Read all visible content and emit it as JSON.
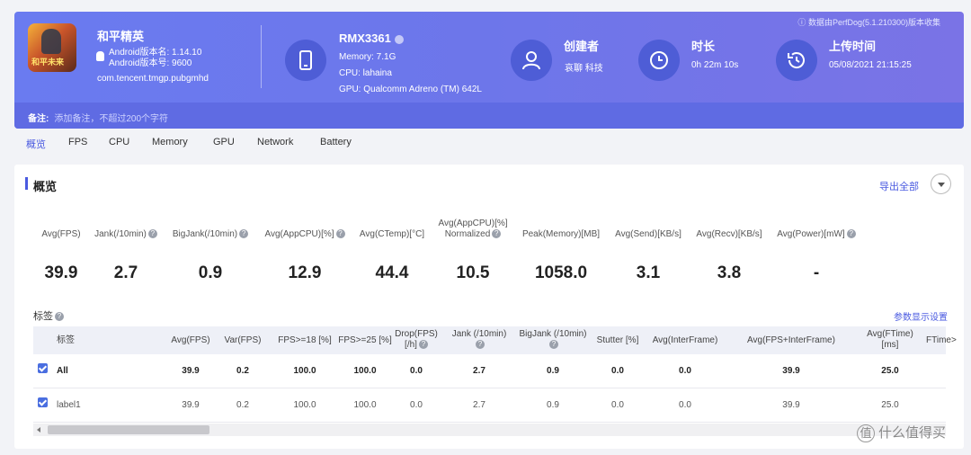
{
  "header": {
    "app": {
      "name": "和平精英",
      "version_name": "Android版本名: 1.14.10",
      "version_code": "Android版本号: 9600",
      "package": "com.tencent.tmgp.pubgmhd",
      "icon_text": "和平未来"
    },
    "device": {
      "name": "RMX3361",
      "memory": "Memory: 7.1G",
      "cpu": "CPU: lahaina",
      "gpu": "GPU: Qualcomm Adreno (TM) 642L"
    },
    "creator": {
      "title": "创建者",
      "value": "哀聊 科技"
    },
    "duration": {
      "title": "时长",
      "value": "0h 22m 10s"
    },
    "upload": {
      "title": "上传时间",
      "value": "05/08/2021 21:15:25"
    },
    "perfdog_note": "数据由PerfDog(5.1.210300)版本收集",
    "note_label": "备注:",
    "note_placeholder": "添加备注，不超过200个字符"
  },
  "tabs": [
    "概览",
    "FPS",
    "CPU",
    "Memory",
    "GPU",
    "Network",
    "Battery"
  ],
  "overview": {
    "title": "概览",
    "export_label": "导出全部",
    "stats": [
      {
        "label": "Avg(FPS)",
        "label2": "",
        "value": "39.9",
        "help": false
      },
      {
        "label": "Jank(/10min)",
        "label2": "",
        "value": "2.7",
        "help": true
      },
      {
        "label": "BigJank(/10min)",
        "label2": "",
        "value": "0.9",
        "help": true
      },
      {
        "label": "Avg(AppCPU)[%]",
        "label2": "",
        "value": "12.9",
        "help": true
      },
      {
        "label": "Avg(CTemp)[°C]",
        "label2": "",
        "value": "44.4",
        "help": false
      },
      {
        "label": "Avg(AppCPU)[%]",
        "label2": "Normalized",
        "value": "10.5",
        "help": true
      },
      {
        "label": "Peak(Memory)[MB]",
        "label2": "",
        "value": "1058.0",
        "help": false
      },
      {
        "label": "Avg(Send)[KB/s]",
        "label2": "",
        "value": "3.1",
        "help": false
      },
      {
        "label": "Avg(Recv)[KB/s]",
        "label2": "",
        "value": "3.8",
        "help": false
      },
      {
        "label": "Avg(Power)[mW]",
        "label2": "",
        "value": "-",
        "help": true
      }
    ]
  },
  "tags": {
    "title": "标签",
    "settings_link": "参数显示设置",
    "columns": [
      {
        "label": "标签",
        "label2": ""
      },
      {
        "label": "Avg(FPS)",
        "label2": ""
      },
      {
        "label": "Var(FPS)",
        "label2": ""
      },
      {
        "label": "FPS>=18 [%]",
        "label2": ""
      },
      {
        "label": "FPS>=25 [%]",
        "label2": ""
      },
      {
        "label": "Drop(FPS)",
        "label2": "[/h]"
      },
      {
        "label": "Jank (/10min)",
        "label2": ""
      },
      {
        "label": "BigJank (/10min)",
        "label2": ""
      },
      {
        "label": "Stutter [%]",
        "label2": ""
      },
      {
        "label": "Avg(InterFrame)",
        "label2": ""
      },
      {
        "label": "Avg(FPS+InterFrame)",
        "label2": ""
      },
      {
        "label": "Avg(FTime)",
        "label2": "[ms]"
      },
      {
        "label": "FTime>",
        "label2": ""
      }
    ],
    "rows": [
      {
        "name": "All",
        "values": [
          "39.9",
          "0.2",
          "100.0",
          "100.0",
          "0.0",
          "2.7",
          "0.9",
          "0.0",
          "0.0",
          "39.9",
          "25.0"
        ]
      },
      {
        "name": "label1",
        "values": [
          "39.9",
          "0.2",
          "100.0",
          "100.0",
          "0.0",
          "2.7",
          "0.9",
          "0.0",
          "0.0",
          "39.9",
          "25.0"
        ]
      }
    ]
  },
  "watermark": "什么值得买"
}
